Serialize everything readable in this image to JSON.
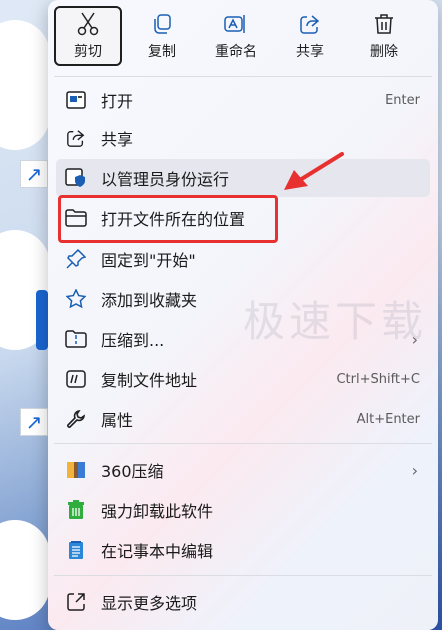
{
  "toolbar": {
    "cut": "剪切",
    "copy": "复制",
    "rename": "重命名",
    "share": "共享",
    "delete": "删除"
  },
  "menu": {
    "open": {
      "label": "打开",
      "shortcut": "Enter"
    },
    "share": {
      "label": "共享"
    },
    "run_as_admin": {
      "label": "以管理员身份运行"
    },
    "open_location": {
      "label": "打开文件所在的位置"
    },
    "pin_start": {
      "label": "固定到\"开始\""
    },
    "add_favorites": {
      "label": "添加到收藏夹"
    },
    "compress": {
      "label": "压缩到..."
    },
    "copy_path": {
      "label": "复制文件地址",
      "shortcut": "Ctrl+Shift+C"
    },
    "properties": {
      "label": "属性",
      "shortcut": "Alt+Enter"
    },
    "zip360": {
      "label": "360压缩"
    },
    "uninstall": {
      "label": "强力卸载此软件"
    },
    "notepad": {
      "label": "在记事本中编辑"
    },
    "more": {
      "label": "显示更多选项"
    }
  },
  "watermark": "极速下载",
  "colors": {
    "highlight": "#e83030",
    "accent": "#1a66d2"
  }
}
